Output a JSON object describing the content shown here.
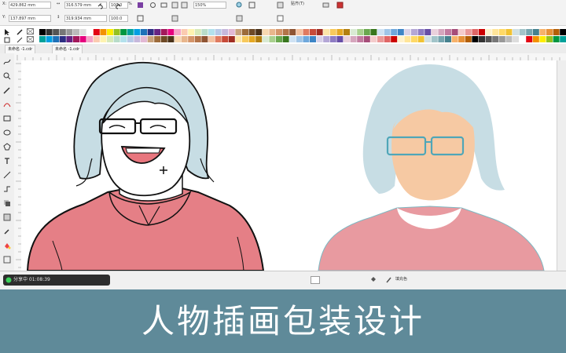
{
  "propbar": {
    "x_label": "X:",
    "x_value": "429.862 mm",
    "y_label": "Y:",
    "y_value": "137.897 mm",
    "w_value": "316.579 mm",
    "h_value": "319.934 mm",
    "scale_w": "100.0",
    "scale_h": "100.0",
    "percent": "%",
    "zoom_value": "150%",
    "snap_menu": "贴齐(T)"
  },
  "tabs": [
    {
      "label": "未命名 -1.cdr"
    },
    {
      "label": "未命名 -1.cdr"
    }
  ],
  "status": {
    "recording_label": "分享中 01:08:39",
    "fill_label": "填充色"
  },
  "banner": {
    "title": "人物插画包装设计"
  },
  "colors": {
    "banner_bg": "#5f8a99",
    "skin_fill": "#f6c9a3",
    "hair_fill": "#c7dde4",
    "shirt_fill": "#e57f86",
    "mouth_fill": "#e8767e"
  },
  "icons": [
    "undo-icon",
    "redo-icon",
    "import-icon",
    "export-icon",
    "zoom-icon",
    "snap-icon",
    "pick-tool-icon",
    "shape-tool-icon",
    "crop-tool-icon",
    "zoom-tool-icon",
    "freehand-tool-icon",
    "rectangle-tool-icon",
    "ellipse-tool-icon",
    "polygon-tool-icon",
    "text-tool-icon",
    "parallel-dimension-icon",
    "connector-icon",
    "drop-shadow-icon",
    "transparency-icon",
    "eyedropper-icon",
    "interactive-fill-icon",
    "smart-fill-icon",
    "cursor-crosshair-icon",
    "record-dot-icon"
  ]
}
